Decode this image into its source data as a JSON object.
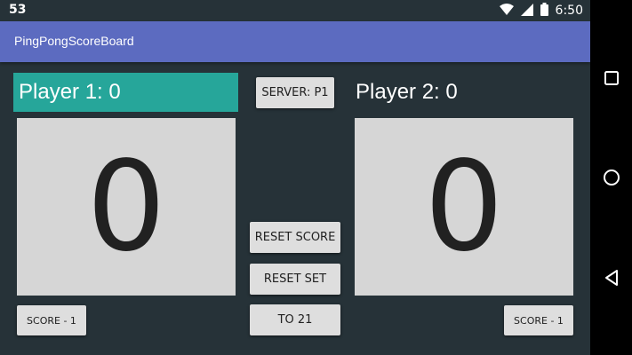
{
  "status": {
    "left_text": "53",
    "time": "6:50"
  },
  "appbar": {
    "title": "PingPongScoreBoard"
  },
  "player1": {
    "label": "Player 1: 0",
    "score": "0",
    "score_minus_label": "SCORE - 1"
  },
  "player2": {
    "label": "Player 2: 0",
    "score": "0",
    "score_minus_label": "SCORE - 1"
  },
  "controls": {
    "server_label": "SERVER: P1",
    "reset_score_label": "RESET SCORE",
    "reset_set_label": "RESET SET",
    "to21_label": "TO 21"
  },
  "colors": {
    "appbar": "#5C6BC0",
    "background": "#263238",
    "player1_label_bg": "#26A69A",
    "score_panel": "#d6d6d6"
  },
  "icons": {
    "status": [
      "wifi-icon",
      "signal-icon",
      "battery-icon"
    ],
    "nav": [
      "recents-icon",
      "home-icon",
      "back-icon"
    ]
  }
}
